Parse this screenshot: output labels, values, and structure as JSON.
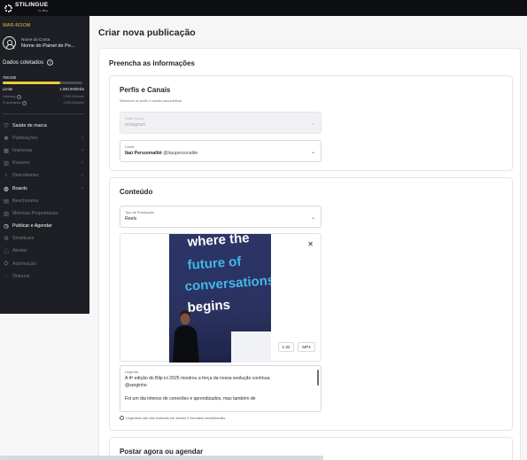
{
  "brand": {
    "name": "STILINGUE",
    "sub": "by Blip"
  },
  "sidebar": {
    "section": "WAR-ROOM",
    "account_label": "Nome da Conta",
    "account_name": "Nome do Painel de Pe...",
    "collected_label": "Dados coletados",
    "usage_value": "750.000",
    "usage_fraction": 0.72,
    "limit_label": "Limite",
    "limit_value": "1.000.000/mês",
    "listening_label": "Listening",
    "listening_value": "1.000.000/mês",
    "owned_label": "Proprietários",
    "owned_value": "1.000.000/mês",
    "nav": [
      {
        "label": "Saúde de marca",
        "icon": "heart-icon",
        "chevron": false
      },
      {
        "label": "Publicações",
        "icon": "sun-icon",
        "chevron": true
      },
      {
        "label": "Imprensa",
        "icon": "grid-icon",
        "chevron": true
      },
      {
        "label": "Resumo",
        "icon": "bar-chart-icon",
        "chevron": true
      },
      {
        "label": "Descobertas",
        "icon": "bulb-icon",
        "chevron": true
      },
      {
        "label": "Boards",
        "icon": "board-icon",
        "chevron": true
      },
      {
        "label": "Benchmarks",
        "icon": "benchmark-icon",
        "chevron": false
      },
      {
        "label": "Métricas Proprietárias",
        "icon": "metrics-icon",
        "chevron": false
      },
      {
        "label": "Publicar e Agendar",
        "icon": "clock-icon",
        "chevron": false
      },
      {
        "label": "Smartcare",
        "icon": "smartcare-icon",
        "chevron": false
      },
      {
        "label": "Alertas",
        "icon": "alert-icon",
        "chevron": false
      },
      {
        "label": "Automação",
        "icon": "automation-icon",
        "chevron": false
      },
      {
        "label": "Otimizar",
        "icon": "optimize-icon",
        "chevron": false
      }
    ]
  },
  "main": {
    "title": "Criar nova publicação",
    "form_title": "Preencha as informações",
    "profiles": {
      "title": "Perfis e Canais",
      "subtitle": "Selecione os perfis e canais para publicar",
      "social_label": "Rede Social",
      "social_value": "Instagram",
      "account_label": "Conta",
      "account_name": "Itaú Personnalité",
      "account_handle": "@itaupersonalite"
    },
    "content": {
      "title": "Conteúdo",
      "type_label": "Tipo de Publicação",
      "type_value": "Reels",
      "media_text": [
        "where the",
        "future of",
        "conversations",
        "begins"
      ],
      "duration": "1:32",
      "format": "MP4",
      "caption_label": "Legenda",
      "caption_line1": "A 4ª edição do Blip ici 2025 mostrou a força da nossa evolução contínua.",
      "caption_line2": "@serginho",
      "caption_line3": "Foi um dia intenso de conexões e aprendizados, mas também de",
      "caption_note": "Legendas não são exibidas em stories e formatos semelhantes."
    },
    "schedule": {
      "title": "Postar agora ou agendar"
    }
  }
}
